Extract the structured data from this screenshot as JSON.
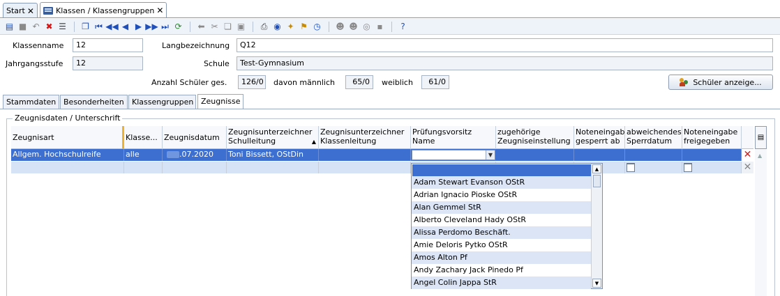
{
  "window_tabs": [
    {
      "label": "Start",
      "close": "✕"
    },
    {
      "label": "Klassen / Klassengruppen",
      "close": "✕"
    }
  ],
  "toolbar_icons": [
    "new-icon",
    "save-icon",
    "undo-icon",
    "delete-icon",
    "properties-icon",
    "copy-record-icon",
    "first-icon",
    "prev-page-icon",
    "prev-icon",
    "next-icon",
    "next-page-icon",
    "last-icon",
    "refresh-icon",
    "back-icon",
    "cut-icon",
    "copy-icon",
    "paste-icon",
    "print-icon",
    "preview-icon",
    "hint-icon",
    "clean-icon",
    "clock-icon",
    "users-icon",
    "group-icon",
    "attach-icon",
    "note-icon",
    "help-icon"
  ],
  "form": {
    "klassenname_label": "Klassenname",
    "klassenname_value": "12",
    "langbezeichnung_label": "Langbezeichnung",
    "langbezeichnung_value": "Q12",
    "jahrgangsstufe_label": "Jahrgangsstufe",
    "jahrgangsstufe_value": "12",
    "schule_label": "Schule",
    "schule_value": "Test-Gymnasium",
    "anzahl_label": "Anzahl Schüler ges.",
    "anzahl_value": "126/0",
    "maennlich_label": "davon männlich",
    "maennlich_value": "65/0",
    "weiblich_label": "weiblich",
    "weiblich_value": "61/0",
    "show_students_button": "Schüler anzeige..."
  },
  "sub_tabs": [
    "Stammdaten",
    "Besonderheiten",
    "Klassengruppen",
    "Zeugnisse"
  ],
  "active_sub_tab": "Zeugnisse",
  "group_title": "Zeugnisdaten / Unterschrift",
  "table": {
    "columns": [
      {
        "line1": "Zeugnisart",
        "line2": ""
      },
      {
        "line1": "Klasse...",
        "line2": ""
      },
      {
        "line1": "Zeugnisdatum",
        "line2": ""
      },
      {
        "line1": "Zeugnisunterzeichner",
        "line2": "Schulleitung"
      },
      {
        "line1": "Zeugnisunterzeichner",
        "line2": "Klassenleitung"
      },
      {
        "line1": "Prüfungsvorsitz",
        "line2": "Name"
      },
      {
        "line1": "zugehörige",
        "line2": "Zeugniseinstellung"
      },
      {
        "line1": "Noteneingab",
        "line2": "gesperrt ab"
      },
      {
        "line1": "abweichendes",
        "line2": "Sperrdatum"
      },
      {
        "line1": "Noteneingabe",
        "line2": "freigegeben"
      }
    ],
    "rows": [
      {
        "zeugnisart": "Allgem. Hochschulreife",
        "klasse": "alle",
        "datum": ".07.2020",
        "schulleitung": "Toni Bissett, OStDin"
      }
    ]
  },
  "dropdown_items": [
    "Adam Stewart Evanson OStR",
    "Adrian Ignacio Pioske OStR",
    "Alan Gemmel StR",
    "Alberto Cleveland Hady OStR",
    "Alissa Perdomo Beschäft.",
    "Amie Deloris Pytko OStR",
    "Amos Alton Pf",
    "Andy Zachary Jack Pinedo Pf",
    "Angel Colin Jappa StR"
  ]
}
